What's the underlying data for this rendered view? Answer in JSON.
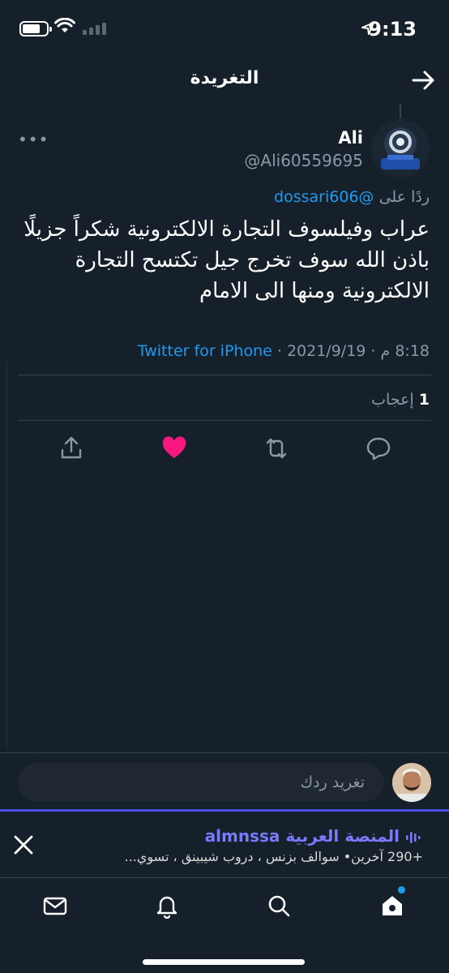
{
  "status_bar": {
    "time": "9:13",
    "battery_level": 0.75
  },
  "header": {
    "title": "التغريدة"
  },
  "tweet": {
    "author_name": "Ali",
    "author_handle": "@Ali60559695",
    "reply_prefix": "ردًا على",
    "reply_mention": "@dossari606",
    "text": "عراب وفيلسوف التجارة الالكترونية شكراً جزيلًا باذن الله سوف تخرج جيل تكتسح التجارة الالكترونية ومنها الى الامام",
    "time": "8:18 م",
    "date": "2021/9/19",
    "source": "Twitter for iPhone",
    "likes_count": "1",
    "likes_label": "إعجاب"
  },
  "reply_box": {
    "placeholder": "تغريد ردك"
  },
  "space": {
    "title": "المنصة العربية almnssa",
    "subtitle": "+290 آخرين•  سوالف بزنس ، دروب شيبينق ، تسوي..."
  },
  "colors": {
    "accent": "#1d9bf0",
    "like": "#f91880",
    "space": "#7b79ff",
    "background": "#15202b"
  }
}
